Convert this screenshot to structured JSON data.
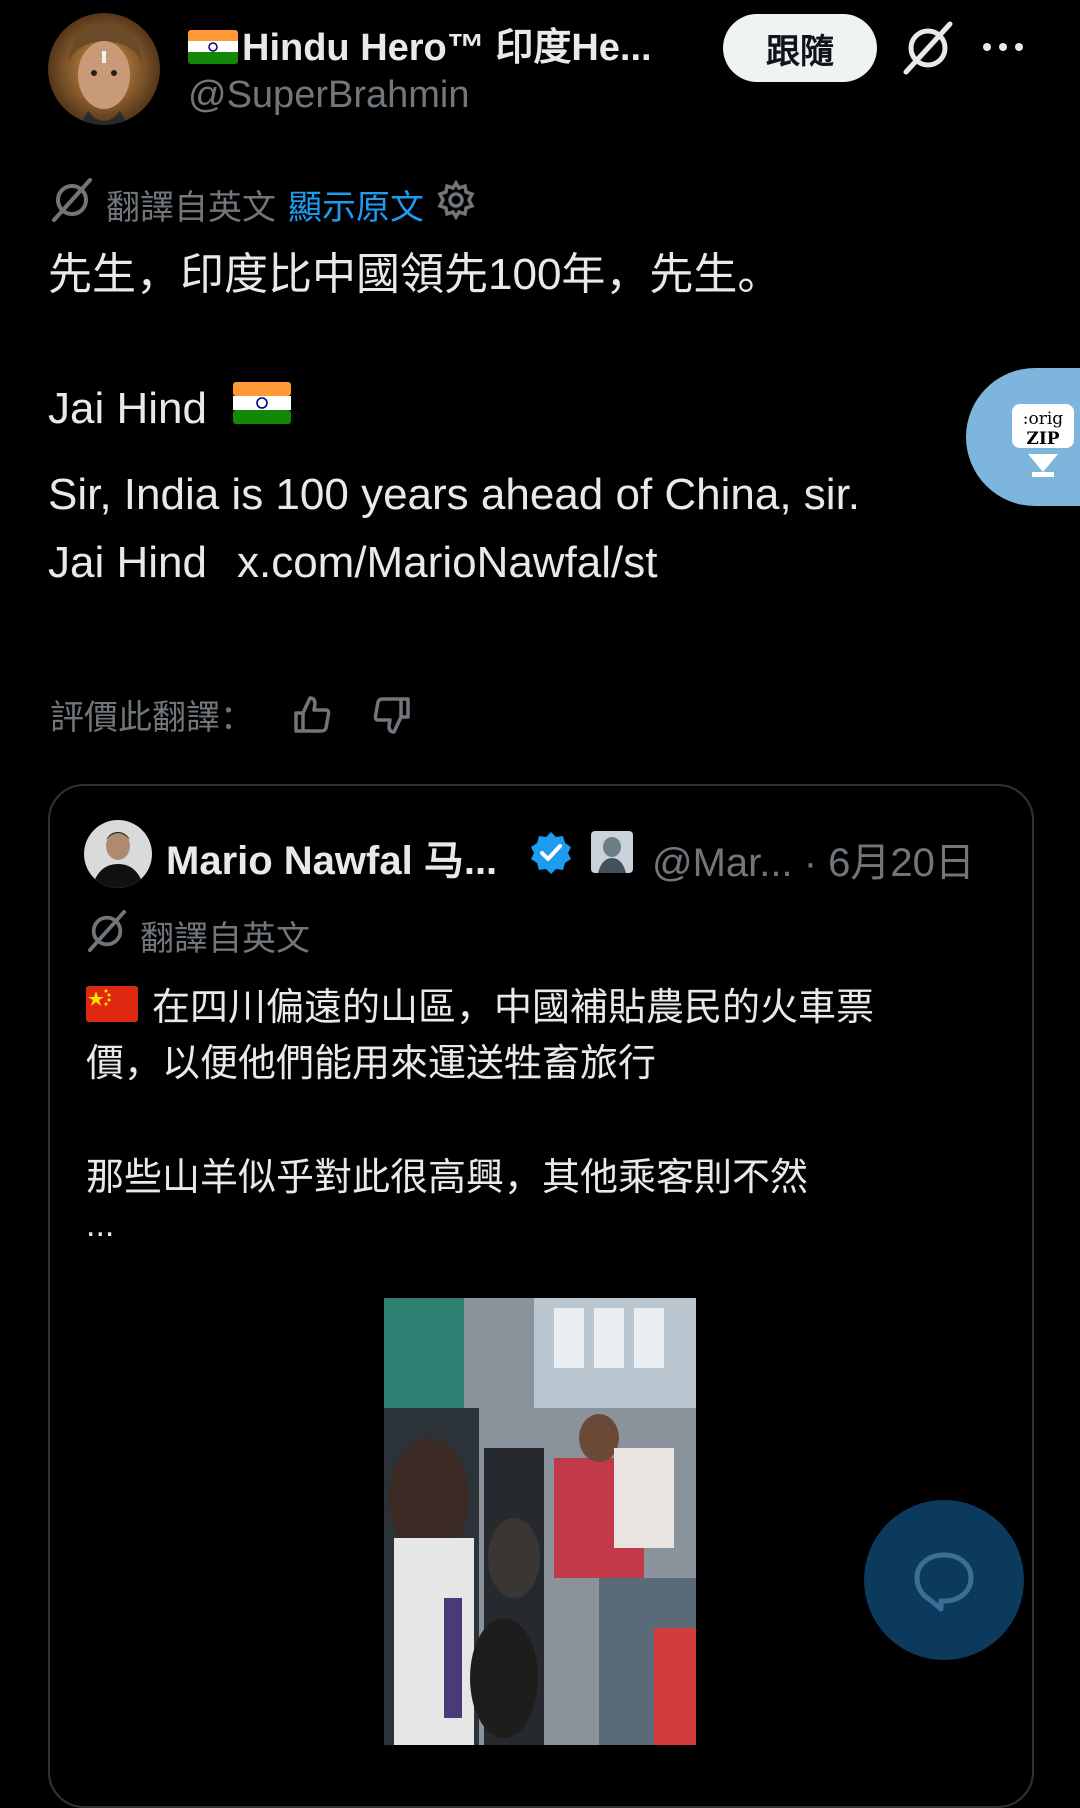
{
  "author": {
    "display_name": "Hindu Hero™ 印度He...",
    "handle": "@SuperBrahmin",
    "follow_label": "跟隨"
  },
  "translation": {
    "label": "翻譯自英文",
    "show_original": "顯示原文"
  },
  "tweet": {
    "translated_text": "先生，印度比中國領先100年，先生。",
    "jai_hind": "Jai Hind",
    "original_line1": "Sir, India is 100 years ahead of China, sir.",
    "original_line2_text": "Jai Hind",
    "original_link": "x.com/MarioNawfal/st"
  },
  "rating": {
    "label": "評價此翻譯："
  },
  "zip_tab": {
    "line1": ":orig",
    "line2": "ZIP"
  },
  "quote": {
    "display_name": "Mario Nawfal 马...",
    "handle": "@Mar...",
    "date": "· 6月20日",
    "translation_label": "翻譯自英文",
    "line1": "在四川偏遠的山區，中國補貼農民的火車票",
    "line2": "價，以便他們能用來運送牲畜旅行",
    "line3": "那些山羊似乎對此很高興，其他乘客則不然",
    "ellipsis": "..."
  },
  "colors": {
    "background": "#000000",
    "text": "#e7e9ea",
    "muted": "#71767b",
    "link": "#1d9bf0",
    "follow_bg": "#eff3f4",
    "verified": "#1d9bf0",
    "fab": "#0b3a5c",
    "zip_tab": "#7eb5dc"
  }
}
